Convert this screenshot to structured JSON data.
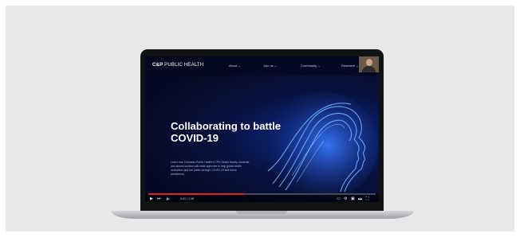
{
  "site": {
    "logo_strong": "C&P",
    "logo_rest": "PUBLIC HEALTH",
    "nav": [
      {
        "label": "About ⌄"
      },
      {
        "label": "Join us ⌄"
      },
      {
        "label": "Community ⌄"
      },
      {
        "label": "Research ⌄"
      }
    ]
  },
  "hero": {
    "title": "Collaborating to battle COVID-19",
    "body": "Learn how Columbia Public Health’s CPH Studio faculty, students, and alumni worked with state agencies to help guide health authorities and the public through COVID-19 and future pandemics."
  },
  "player": {
    "progress": 0.42,
    "time": "0:41 / 1:38",
    "icons": [
      "play-icon",
      "next-icon",
      "volume-icon",
      "subtitles-icon",
      "settings-icon",
      "miniplayer-icon",
      "theater-icon",
      "fullscreen-icon"
    ]
  },
  "colors": {
    "background_panel": "#e7e8e9",
    "bezel": "#111214",
    "screen_dark": "#050a24",
    "accent_blue": "#1e5cff",
    "progress_red": "#e02424"
  }
}
